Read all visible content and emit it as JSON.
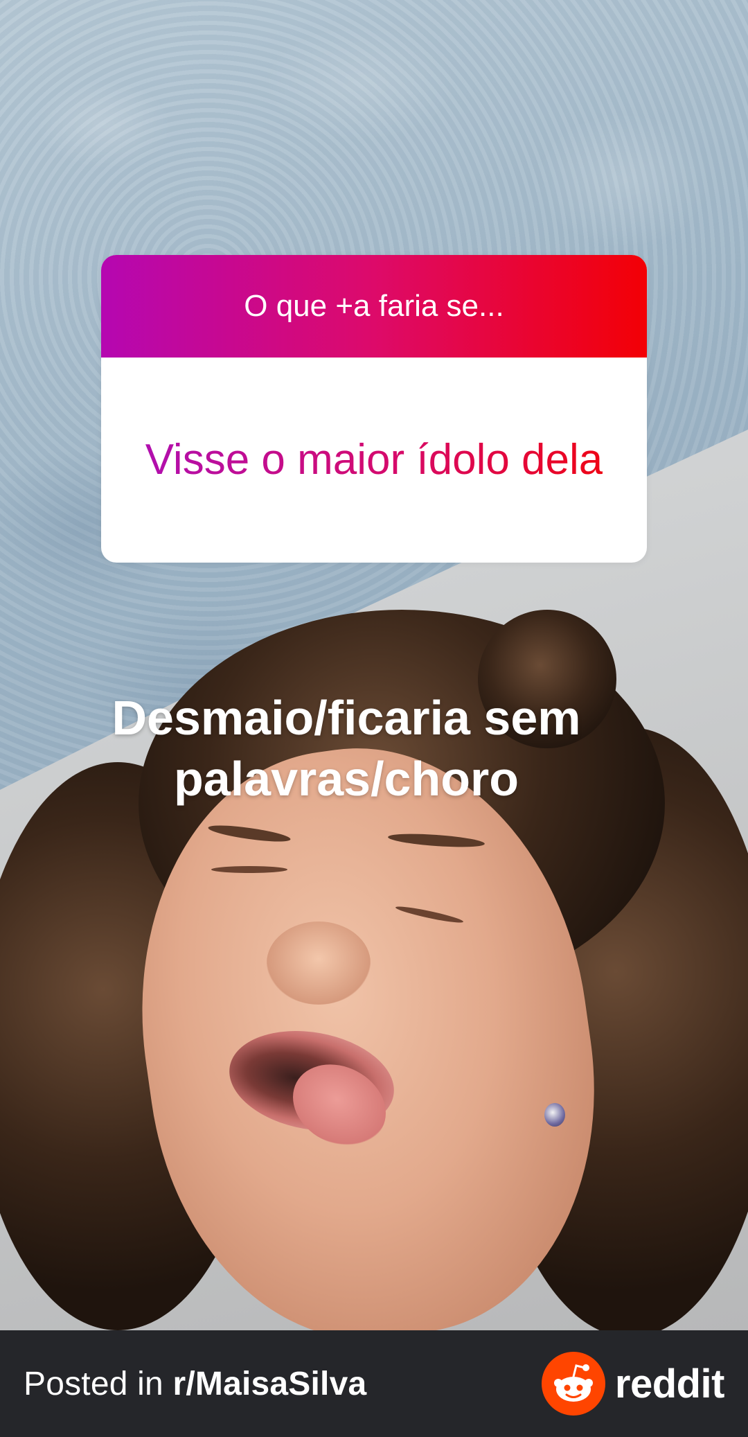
{
  "story": {
    "question_sticker": {
      "prompt": "O que +a faria se...",
      "answer": "Visse o maior ídolo dela"
    },
    "caption": {
      "line1": "Desmaio/ficaria sem",
      "line2": "palavras/choro"
    }
  },
  "footer": {
    "posted_prefix": "Posted in ",
    "subreddit": "r/MaisaSilva",
    "brand": "reddit"
  },
  "colors": {
    "sticker_gradient_start": "#b507b1",
    "sticker_gradient_end": "#f30005",
    "reddit_orange": "#ff4500",
    "footer_bg": "#25262a"
  },
  "icons": {
    "reddit_logo": "reddit-snoo-icon"
  }
}
